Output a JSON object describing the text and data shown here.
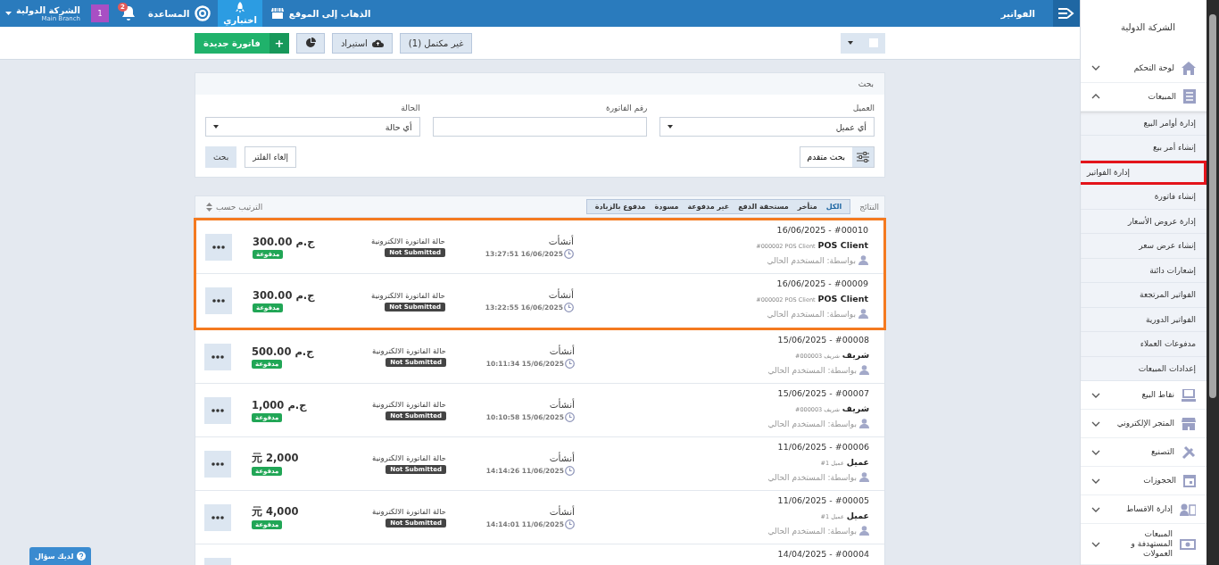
{
  "topbar": {
    "company": "الشركة الدولية",
    "branch": "Main Branch",
    "user_badge": "1",
    "notifications_count": "2",
    "help": "المساعدة",
    "nav": [
      {
        "label": "اختباري",
        "selected": true,
        "kind": "rocket"
      },
      {
        "label": "الذهاب إلى الموقع",
        "selected": false,
        "kind": "store"
      }
    ],
    "page_title": "الفواتير"
  },
  "toolbar": {
    "incomplete_button": "غير مكتمل (1)",
    "import_button": "استيراد",
    "new_invoice_button": "فاتورة جديدة",
    "new_invoice_plus": "+",
    "select_all_checked": false
  },
  "search": {
    "title": "بحث",
    "fields": [
      {
        "label": "العميل",
        "kind": "select",
        "value": "أي عميل"
      },
      {
        "label": "رقم الفاتورة",
        "kind": "text"
      },
      {
        "label": "الحالة",
        "kind": "select",
        "value": "أي حالة"
      }
    ],
    "advanced_button": "بحث متقدم",
    "clear_button": "إلغاء الفلتر",
    "search_button": "بحث"
  },
  "results": {
    "title": "النتائج",
    "sort_label": "الترتيب حسب",
    "filters": [
      {
        "label": "الكل",
        "selected": true
      },
      {
        "label": "متأخر",
        "selected": false
      },
      {
        "label": "مستحقة الدفع",
        "selected": false
      },
      {
        "label": "غير مدفوعة",
        "selected": false
      },
      {
        "label": "مسودة",
        "selected": false
      },
      {
        "label": "مدفوع بالزيادة",
        "selected": false
      }
    ]
  },
  "rows": [
    {
      "number": "16/06/2025 - #00010",
      "client": "POS Client",
      "client_code": "#000002 POS Client",
      "by": "بواسطة: المستخدم الحالي",
      "created_label": "أنشأت",
      "created_at": "13:27:51 16/06/2025",
      "einvoice_label": "حالة الفاتورة الالكترونية",
      "einvoice_status": "Not Submitted",
      "amount": "300.00 ج.م",
      "status": "مدفوعة",
      "highlighted": true
    },
    {
      "number": "16/06/2025 - #00009",
      "client": "POS Client",
      "client_code": "#000002 POS Client",
      "by": "بواسطة: المستخدم الحالي",
      "created_label": "أنشأت",
      "created_at": "13:22:55 16/06/2025",
      "einvoice_label": "حالة الفاتورة الالكترونية",
      "einvoice_status": "Not Submitted",
      "amount": "300.00 ج.م",
      "status": "مدفوعة",
      "highlighted": true
    },
    {
      "number": "15/06/2025 - #00008",
      "client": "شريف",
      "client_code": "#000003 شريف",
      "by": "بواسطة: المستخدم الحالي",
      "created_label": "أنشأت",
      "created_at": "10:11:34 15/06/2025",
      "einvoice_label": "حالة الفاتورة الالكترونية",
      "einvoice_status": "Not Submitted",
      "amount": "500.00 ج.م",
      "status": "مدفوعة",
      "highlighted": false
    },
    {
      "number": "15/06/2025 - #00007",
      "client": "شريف",
      "client_code": "#000003 شريف",
      "by": "بواسطة: المستخدم الحالي",
      "created_label": "أنشأت",
      "created_at": "10:10:58 15/06/2025",
      "einvoice_label": "حالة الفاتورة الالكترونية",
      "einvoice_status": "Not Submitted",
      "amount": "1,000 ج.م",
      "status": "مدفوعة",
      "highlighted": false
    },
    {
      "number": "11/06/2025 - #00006",
      "client": "عميل",
      "client_code": "#1 عميل",
      "by": "بواسطة: المستخدم الحالي",
      "created_label": "أنشأت",
      "created_at": "14:14:26 11/06/2025",
      "einvoice_label": "حالة الفاتورة الالكترونية",
      "einvoice_status": "Not Submitted",
      "amount": "元 2,000",
      "status": "مدفوعة",
      "highlighted": false
    },
    {
      "number": "11/06/2025 - #00005",
      "client": "عميل",
      "client_code": "#1 عميل",
      "by": "بواسطة: المستخدم الحالي",
      "created_label": "أنشأت",
      "created_at": "14:14:01 11/06/2025",
      "einvoice_label": "حالة الفاتورة الالكترونية",
      "einvoice_status": "Not Submitted",
      "amount": "元 4,000",
      "status": "مدفوعة",
      "highlighted": false
    },
    {
      "number": "14/04/2025 - #00004",
      "highlighted": false
    }
  ],
  "sidebar": {
    "company": "الشركة الدولية",
    "items": [
      {
        "label": "لوحة التحكم",
        "expanded": false
      },
      {
        "label": "المبيعات",
        "expanded": true,
        "children": [
          {
            "label": "إدارة أوامر البيع",
            "selected": false
          },
          {
            "label": "إنشاء أمر بيع",
            "selected": false
          },
          {
            "label": "إدارة الفواتير",
            "selected": true
          },
          {
            "label": "إنشاء فاتورة",
            "selected": false
          },
          {
            "label": "إدارة عروض الأسعار",
            "selected": false
          },
          {
            "label": "إنشاء عرض سعر",
            "selected": false
          },
          {
            "label": "إشعارات دائنة",
            "selected": false
          },
          {
            "label": "الفواتير المرتجعة",
            "selected": false
          },
          {
            "label": "الفواتير الدورية",
            "selected": false
          },
          {
            "label": "مدفوعات العملاء",
            "selected": false
          },
          {
            "label": "إعدادات المبيعات",
            "selected": false
          }
        ]
      },
      {
        "label": "نقاط البيع",
        "expanded": false
      },
      {
        "label": "المتجر الإلكتروني",
        "expanded": false
      },
      {
        "label": "التصنيع",
        "expanded": false
      },
      {
        "label": "الحجوزات",
        "expanded": false
      },
      {
        "label": "إدارة الاقساط",
        "expanded": false
      },
      {
        "label": "المبيعات المستهدفة و العمولات",
        "expanded": false
      }
    ]
  },
  "help_button": "لديك سؤال"
}
